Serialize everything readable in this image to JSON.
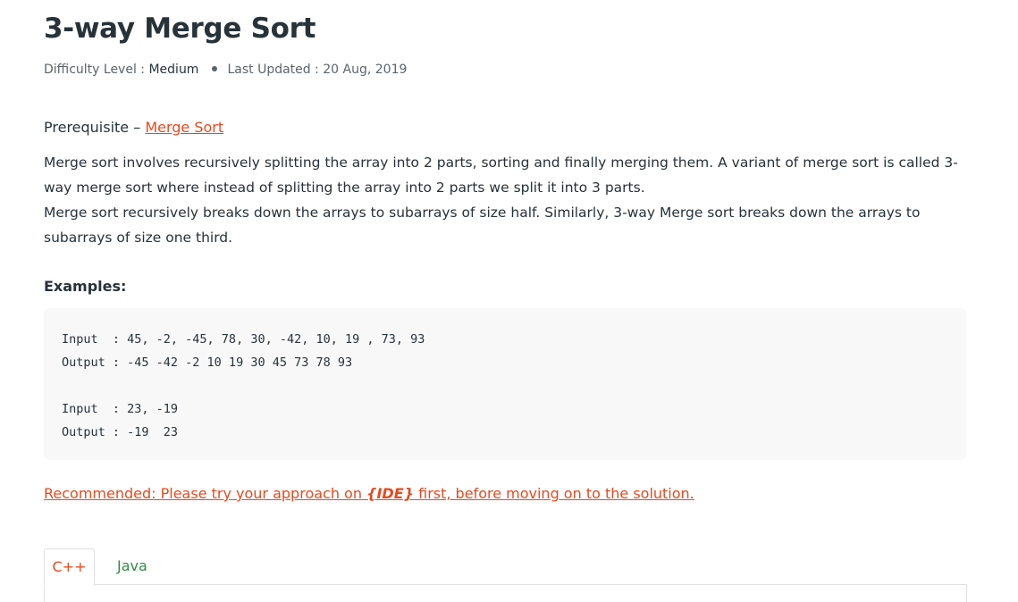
{
  "article": {
    "title": "3-way Merge Sort",
    "meta": {
      "difficulty_label": "Difficulty Level : ",
      "difficulty_value": "Medium",
      "updated_label": "Last Updated : 20 Aug, 2019"
    },
    "prerequisite": {
      "label": "Prerequisite – ",
      "link_text": "Merge Sort"
    },
    "paragraphs": [
      "Merge sort involves recursively splitting the array into 2 parts, sorting and finally merging them. A variant of merge sort is called 3-way merge sort where instead of splitting the array into 2 parts we split it into 3 parts.",
      "Merge sort recursively breaks down the arrays to subarrays of size half. Similarly, 3-way Merge sort breaks down the arrays to subarrays of size one third."
    ],
    "examples_heading": "Examples:",
    "examples_code": "Input  : 45, -2, -45, 78, 30, -42, 10, 19 , 73, 93 \nOutput : -45 -42 -2 10 19 30 45 73 78 93\n\nInput  : 23, -19\nOutput : -19  23",
    "recommended": {
      "prefix": "Recommended: Please try your approach on ",
      "ide": "{IDE}",
      "suffix": " first, before moving on to the solution."
    },
    "tabs": [
      {
        "label": "C++",
        "active": true
      },
      {
        "label": "Java",
        "active": false
      }
    ]
  },
  "colors": {
    "accent_link": "#e8491d",
    "tab_inactive": "#2f8d46",
    "text": "#273239",
    "code_bg": "#f8f8f8"
  }
}
